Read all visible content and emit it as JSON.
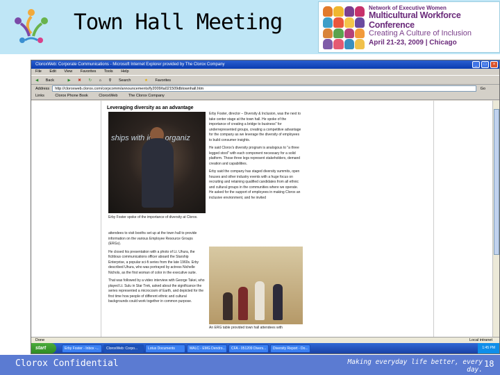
{
  "slide": {
    "title": "Town Hall Meeting",
    "footer_left": "Clorox Confidential",
    "footer_right": "Making everyday life better, every day.",
    "page_number": "18"
  },
  "conference": {
    "line1": "Network of Executive Women",
    "line2": "Multicultural Workforce Conference",
    "line3": "Creating A Culture of Inclusion",
    "line4": "April 21-23, 2009 | Chicago",
    "tile_colors": [
      "#e27a2b",
      "#f0b72f",
      "#7b3f8f",
      "#c7316b",
      "#3e9ec8",
      "#e9573d",
      "#f4c64a",
      "#6b4aa0",
      "#d8843a",
      "#5aa34e",
      "#b5417a",
      "#f29a3b",
      "#7e5ba8",
      "#e45a73",
      "#3a8fc0",
      "#f1c14b"
    ]
  },
  "browser": {
    "window_title": "CloroxWeb: Corporate Communications - Microsoft Internet Explorer provided by The Clorox Company",
    "menu": [
      "File",
      "Edit",
      "View",
      "Favorites",
      "Tools",
      "Help"
    ],
    "toolbar": [
      "Back",
      "Search",
      "Favorites"
    ],
    "address_label": "Address",
    "address_url": "http://cloroxweb.clorox.com/corpcomm/announcements/fy2009/ta021509dbtownhall.htm",
    "go_label": "Go",
    "links_label": "Links",
    "links": [
      "Clorox Phone Book",
      "CloroxWeb",
      "The Clorox Company"
    ],
    "status_left": "Done",
    "status_right": "Local intranet",
    "start_label": "start",
    "taskbar_items": [
      "Erby Foster - Inbox -...",
      "CloroxWeb: Corpo...",
      "Lotus Documents",
      "MALC - EMG Dendro...",
      "CFA - 051209 Divers...",
      "Diversity Report - Do..."
    ],
    "clock": "1:45 PM"
  },
  "article": {
    "headline": "Leveraging diversity as an advantage",
    "photo1_banner": "ships with          ional organiz",
    "para1": "Erby Foster, director – Diversity & Inclusion, was the next to take center stage at the town hall. He spoke of the importance of creating a bridge to business\" for underrepresented groups, creating a competitive advantage for the company as we leverage the diversity of employees to build consumer insights.",
    "para2": "He said Clorox's diversity program is analogous to \"a three legged stool\" with each component necessary for a solid platform. Those three legs represent stakeholders, demand creation and capabilities.",
    "para3": "Erby said the company has staged diversity summits, open houses and other industry events with a huge focus on recruiting and retaining qualified candidates from all ethnic and cultural groups in the communities where we operate. He asked for the support of employees in making Clorox an inclusive environment, and he invited",
    "caption1": "Erby Foster spoke of the importance of diversity at Clorox.",
    "para3_cont": "attendees to visit booths set up at the town hall to provide information on the various Employee Resource Groups (ERGs).",
    "para4": "He closed his presentation with a photo of Lt. Uhura, the fictitious communications officer aboard the Starship Enterprise, a popular sci-fi series from the late 1960s. Erby described Uhura, who was portrayed by actress Nichelle Nichols, as the first woman of color in the executive suite.",
    "para5": "That was followed by a video interview with George Takei, who played Lt. Sulu in Star Trek, asked about the significance the series represented a microcosm of Earth, and depicted for the first time how people of different ethnic and cultural backgrounds could work together in common purpose.",
    "caption2": "An ERG table provided town hall attendees with"
  }
}
